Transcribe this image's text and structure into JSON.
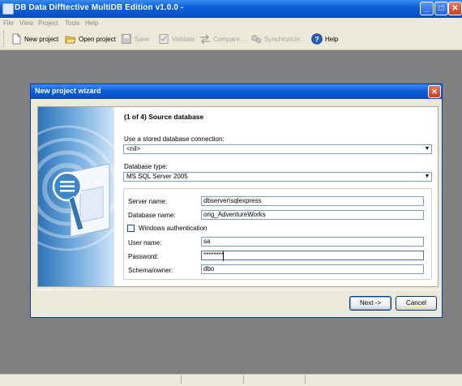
{
  "window": {
    "title": "DB Data Difftective MultiDB Edition v1.0.0 -",
    "controls": {
      "minimize": "_",
      "maximize": "□",
      "close": "✕"
    }
  },
  "menu": [
    "File",
    "View",
    "Project",
    "Tools",
    "Help"
  ],
  "toolbar": [
    {
      "label": "New project",
      "icon": "new-document-icon",
      "enabled": true
    },
    {
      "label": "Open project",
      "icon": "open-folder-icon",
      "enabled": true
    },
    {
      "label": "Save",
      "icon": "save-disk-icon",
      "enabled": false
    },
    {
      "label": "Validate",
      "icon": "validate-checklist-icon",
      "enabled": false
    },
    {
      "label": "Compare...",
      "icon": "compare-arrows-icon",
      "enabled": false
    },
    {
      "label": "Synchronize...",
      "icon": "synchronize-gears-icon",
      "enabled": false
    },
    {
      "label": "Help",
      "icon": "help-circle-icon",
      "enabled": true
    }
  ],
  "dialog": {
    "title": "New project wizard",
    "close": "✕",
    "step_title": "(1 of 4) Source database",
    "stored_connection": {
      "label": "Use a stored database connection:",
      "value": "<nil>"
    },
    "database_type": {
      "label": "Database type:",
      "value": "MS SQL Server 2005"
    },
    "server_name": {
      "label": "Server name:",
      "value": "dbserver\\sqlexpress"
    },
    "database_name": {
      "label": "Database name:",
      "value": "orig_AdventureWorks"
    },
    "windows_auth": {
      "label": "Windows authentication",
      "checked": false
    },
    "user_name": {
      "label": "User name:",
      "value": "sa"
    },
    "password": {
      "label": "Password:",
      "value": "********"
    },
    "schema_owner": {
      "label": "Schema/owner:",
      "value": "dbo"
    },
    "next_button": "Next ->",
    "cancel_button": "Cancel"
  },
  "colors": {
    "titlebar": "#0a5fd8",
    "workspace": "#808080",
    "chrome": "#ece9d8"
  }
}
